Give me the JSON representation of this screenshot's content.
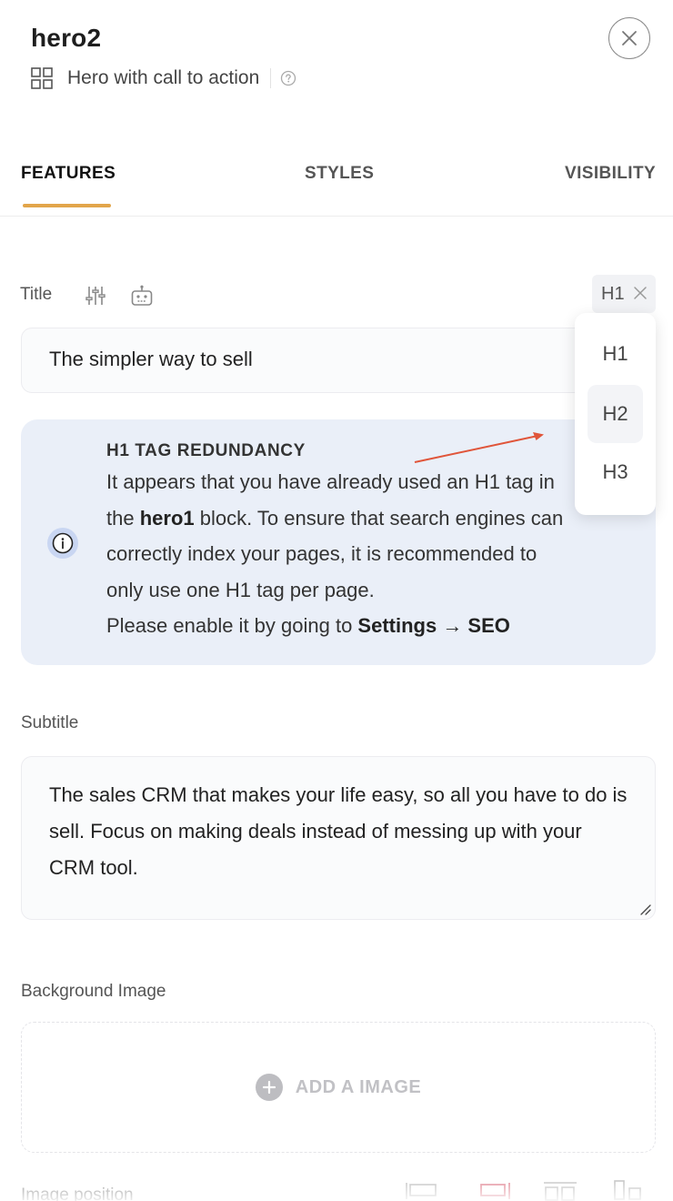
{
  "header": {
    "title": "hero2",
    "subtitle": "Hero with call to action"
  },
  "tabs": [
    {
      "label": "FEATURES",
      "active": true
    },
    {
      "label": "STYLES",
      "active": false
    },
    {
      "label": "VISIBILITY",
      "active": false
    }
  ],
  "title_field": {
    "label": "Title",
    "value": "The simpler way to sell",
    "heading_level": "H1"
  },
  "heading_dropdown": {
    "options": [
      "H1",
      "H2",
      "H3"
    ],
    "hovered": "H2"
  },
  "alert": {
    "title": "H1 TAG REDUNDANCY",
    "line1": "It appears that you have already used an H1 tag in",
    "line2_pre": "the ",
    "line2_bold": "hero1",
    "line2_post": " block. To ensure that search engines can",
    "line3": "correctly index your pages, it is recommended to",
    "line4": "only use one H1 tag per page.",
    "line5_pre": "Please enable it by going to ",
    "line5_bold": "Settings → SEO"
  },
  "subtitle_field": {
    "label": "Subtitle",
    "value": "The sales CRM that makes your life easy, so all you have to do is sell. Focus on making deals instead of messing up with your CRM tool."
  },
  "background_image": {
    "label": "Background Image",
    "add_label": "ADD A IMAGE"
  },
  "image_position": {
    "label": "Image position"
  },
  "colors": {
    "accent": "#e2a54a",
    "alert_bg": "#eaeff8",
    "arrow": "#e0553a",
    "selected_position": "#d0465a"
  }
}
